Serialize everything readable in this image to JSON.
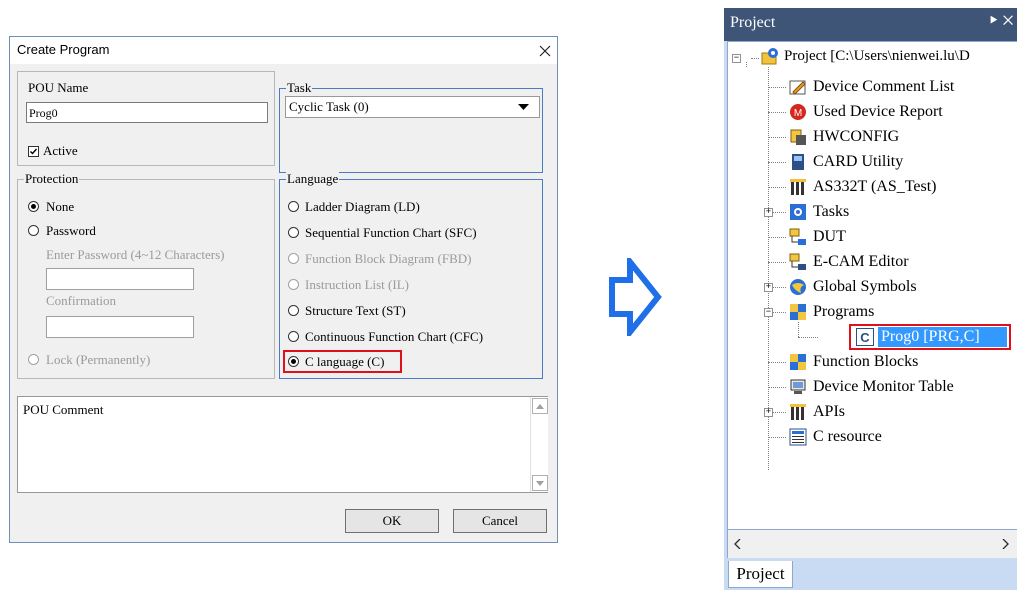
{
  "dialog": {
    "title": "Create Program",
    "pou_name_label": "POU Name",
    "pou_name_value": "Prog0",
    "active_label": "Active",
    "task_legend": "Task",
    "task_selected": "Cyclic Task (0)",
    "protection_legend": "Protection",
    "protection_none": "None",
    "protection_password": "Password",
    "enter_password_label": "Enter Password (4~12 Characters)",
    "confirmation_label": "Confirmation",
    "lock_label": "Lock (Permanently)",
    "language_legend": "Language",
    "languages": [
      "Ladder Diagram (LD)",
      "Sequential Function Chart (SFC)",
      "Function Block Diagram (FBD)",
      "Instruction List (IL)",
      "Structure Text (ST)",
      "Continuous Function Chart (CFC)",
      "C language (C)"
    ],
    "pou_comment_label": "POU Comment",
    "ok_label": "OK",
    "cancel_label": "Cancel"
  },
  "panel": {
    "title": "Project",
    "pin_close": "⯈ ✕",
    "tab_label": "Project",
    "tree": {
      "root": "Project [C:\\Users\\nienwei.lu\\D",
      "items": [
        "Device Comment List",
        "Used Device Report",
        "HWCONFIG",
        "CARD Utility",
        "AS332T  (AS_Test)",
        "Tasks",
        "DUT",
        "E-CAM Editor",
        "Global Symbols",
        "Programs",
        "Prog0 [PRG,C]",
        "Function Blocks",
        "Device Monitor Table",
        "APIs",
        "C resource"
      ]
    }
  },
  "colors": {
    "highlight_red": "#e0101a",
    "selection_blue": "#3399ff",
    "panel_title_bg": "#3e5578",
    "arrow_outline": "#1e6fe8"
  }
}
